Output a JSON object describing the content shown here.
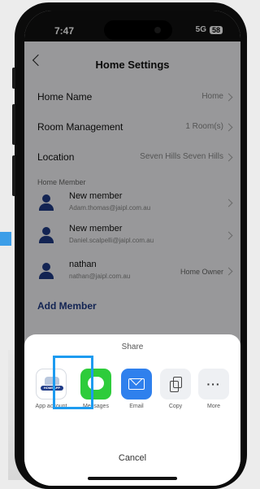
{
  "status": {
    "time": "7:47",
    "network": "5G",
    "battery": "58"
  },
  "nav": {
    "title": "Home Settings"
  },
  "settings": [
    {
      "label": "Home Name",
      "value": "Home"
    },
    {
      "label": "Room Management",
      "value": "1 Room(s)"
    },
    {
      "label": "Location",
      "value": "Seven Hills Seven Hills"
    }
  ],
  "members_section": {
    "label": "Home Member"
  },
  "members": [
    {
      "name": "New member",
      "email": "Adam.thomas@jaipl.com.au",
      "role": ""
    },
    {
      "name": "New member",
      "email": "Daniel.scalpelli@jaipl.com.au",
      "role": ""
    },
    {
      "name": "nathan",
      "email": "nathan@jaipl.com.au",
      "role": "Home Owner"
    }
  ],
  "add_member": "Add Member",
  "share": {
    "title": "Share",
    "items": [
      {
        "label": "App account",
        "icon": "home-app-icon"
      },
      {
        "label": "Messages",
        "icon": "messages-icon"
      },
      {
        "label": "Email",
        "icon": "email-icon"
      },
      {
        "label": "Copy",
        "icon": "copy-icon"
      },
      {
        "label": "More",
        "icon": "more-icon"
      }
    ],
    "app_logo_text": "HOMEAPP",
    "more_glyph": "···",
    "cancel": "Cancel"
  },
  "colors": {
    "accent": "#1f3b87",
    "highlight": "#1d9bf0",
    "messages": "#2ecc3b",
    "email": "#2f80ed"
  }
}
